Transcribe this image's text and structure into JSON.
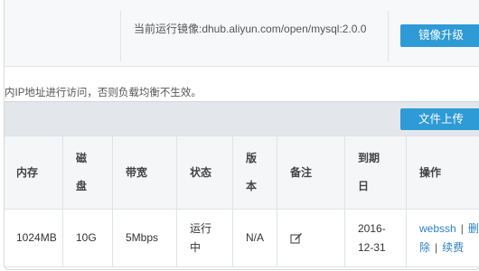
{
  "header": {
    "current_image": "当前运行镜像:dhub.aliyun.com/open/mysql:2.0.0",
    "upgrade_button": "镜像升级"
  },
  "notice": "内IP地址进行访问，否则负载均衡不生效。",
  "toolbar": {
    "upload_button": "文件上传"
  },
  "table": {
    "headers": {
      "memory": "内存",
      "disk_1": "磁",
      "disk_2": "盘",
      "bandwidth": "带宽",
      "status": "状态",
      "version_1": "版",
      "version_2": "本",
      "remark": "备注",
      "expiry_1": "到期",
      "expiry_2": "日",
      "operation": "操作"
    },
    "rows": [
      {
        "memory": "1024MB",
        "disk": "10G",
        "bandwidth": "5Mbps",
        "status_1": "运行",
        "status_2": "中",
        "version": "N/A",
        "expiry_1": "2016-",
        "expiry_2": "12-31",
        "op_webssh": "webssh",
        "op_sep": "|",
        "op_delete_1": "删",
        "op_delete_2": "除",
        "op_renew": "续费"
      }
    ]
  },
  "icons": {
    "remark_edit": "edit-icon"
  },
  "colors": {
    "accent": "#2e9ad6",
    "link": "#2e82c4"
  }
}
